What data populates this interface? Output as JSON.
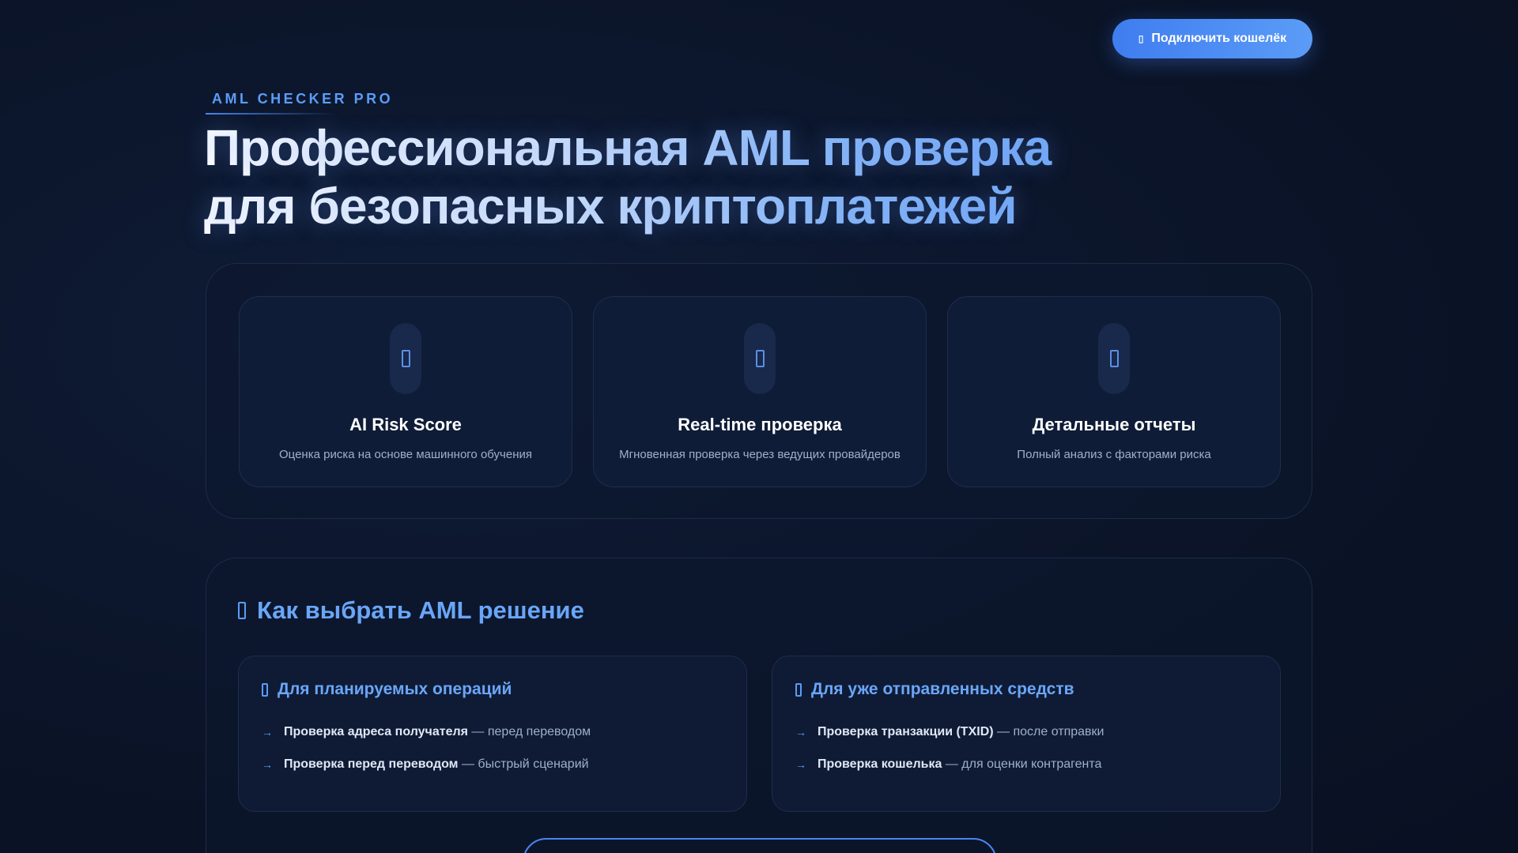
{
  "header": {
    "connect_button": {
      "icon": "wallet-icon",
      "label": "Подключить кошелёк"
    }
  },
  "hero": {
    "badge": "AML CHECKER PRO",
    "title_line1": "Профессиональная AML проверка",
    "title_line2": "для безопасных криптоплатежей"
  },
  "features": [
    {
      "icon": "brain-icon",
      "title": "AI Risk Score",
      "desc": "Оценка риска на основе машинного обучения"
    },
    {
      "icon": "lightning-icon",
      "title": "Real-time проверка",
      "desc": "Мгновенная проверка через ведущих провайдеров"
    },
    {
      "icon": "chart-icon",
      "title": "Детальные отчеты",
      "desc": "Полный анализ с факторами риска"
    }
  ],
  "guide": {
    "icon": "lightbulb-icon",
    "heading": "Как выбрать AML решение",
    "cards": [
      {
        "icon": "calendar-icon",
        "title": "Для планируемых операций",
        "items": [
          {
            "bold": "Проверка адреса получателя",
            "rest": "— перед переводом"
          },
          {
            "bold": "Проверка перед переводом",
            "rest": "— быстрый сценарий"
          }
        ]
      },
      {
        "icon": "search-icon",
        "title": "Для уже отправленных средств",
        "items": [
          {
            "bold": "Проверка транзакции (TXID)",
            "rest": "— после отправки"
          },
          {
            "bold": "Проверка кошелька",
            "rest": "— для оценки контрагента"
          }
        ]
      }
    ],
    "arrow": "→"
  },
  "colors": {
    "accent": "#5b9cf7",
    "button_gradient_start": "#3f7df0",
    "background": "#0b1428"
  }
}
